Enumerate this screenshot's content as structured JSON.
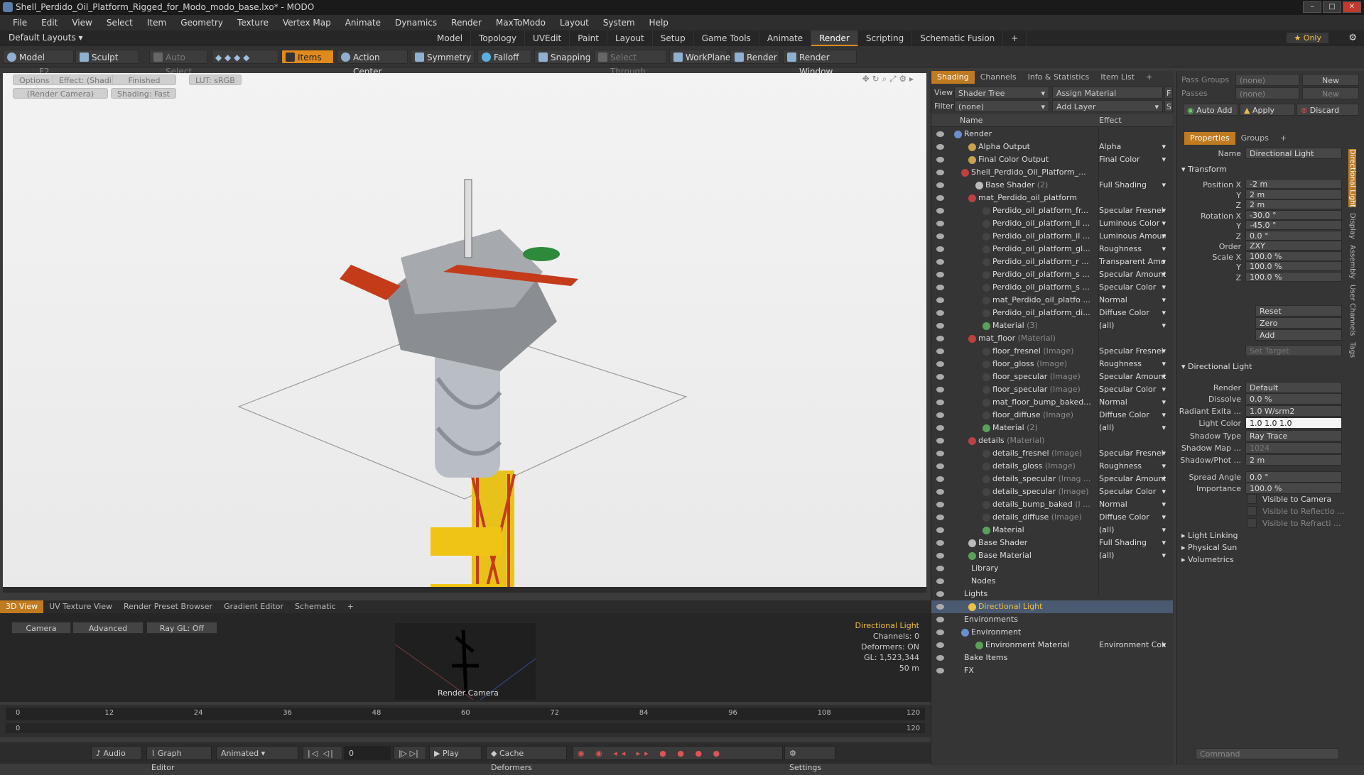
{
  "title": "Shell_Perdido_Oil_Platform_Rigged_for_Modo_modo_base.lxo* - MODO",
  "menu": [
    "File",
    "Edit",
    "View",
    "Select",
    "Item",
    "Geometry",
    "Texture",
    "Vertex Map",
    "Animate",
    "Dynamics",
    "Render",
    "MaxToModo",
    "Layout",
    "System",
    "Help"
  ],
  "layout": {
    "label": "Default Layouts ▾",
    "tabs": [
      "Model",
      "Topology",
      "UVEdit",
      "Paint",
      "Layout",
      "Setup",
      "Game Tools",
      "Animate",
      "Render",
      "Scripting",
      "Schematic Fusion"
    ],
    "active": "Render",
    "only": "★ Only"
  },
  "toolbar": {
    "model": "Model",
    "f2": "F2",
    "sculpt": "Sculpt",
    "auto_select": "Auto Select",
    "items": "Items",
    "action_center": "Action Center",
    "symmetry": "Symmetry",
    "falloff": "Falloff",
    "snapping": "Snapping",
    "select_through": "Select Through",
    "workplane": "WorkPlane",
    "render": "Render",
    "render_window": "Render Window"
  },
  "viewport": {
    "options": "Options",
    "effect": "Effect: (Shadi...",
    "finished": "Finished",
    "lut": "LUT: sRGB",
    "render_camera": "(Render Camera)",
    "shading": "Shading: Fast"
  },
  "bottom_tabs": [
    "3D View",
    "UV Texture View",
    "Render Preset Browser",
    "Gradient Editor",
    "Schematic",
    "+"
  ],
  "preview": {
    "camera": "Camera",
    "advanced": "Advanced",
    "raygl": "Ray GL: Off",
    "cam_label": "Render Camera",
    "info": [
      "Directional Light",
      "Channels: 0",
      "Deformers: ON",
      "GL: 1,523,344",
      "50 m"
    ]
  },
  "timeline": {
    "ticks": [
      "0",
      "12",
      "24",
      "36",
      "48",
      "60",
      "72",
      "84",
      "96",
      "108",
      "120"
    ],
    "ticks2": [
      "0",
      "",
      "",
      "",
      "",
      "120"
    ]
  },
  "transport": {
    "audio": "Audio",
    "graph_editor": "Graph Editor",
    "animated": "Animated",
    "frame": "0",
    "play": "Play",
    "cache": "Cache Deformers",
    "settings": "Settings"
  },
  "shading": {
    "tabs": [
      "Shading",
      "Channels",
      "Info & Statistics",
      "Item List",
      "+"
    ],
    "view_label": "View",
    "view_value": "Shader Tree",
    "assign": "Assign Material",
    "filter_label": "Filter",
    "filter_value": "(none)",
    "add_layer": "Add Layer",
    "f_btn": "F",
    "s_btn": "S",
    "col_name": "Name",
    "col_effect": "Effect",
    "rows": [
      {
        "name": "Render",
        "gray": "",
        "effect": "",
        "indent": 0,
        "color": "#6a8fd0"
      },
      {
        "name": "Alpha Output",
        "gray": "",
        "effect": "Alpha",
        "indent": 2,
        "color": "#c9a24a"
      },
      {
        "name": "Final Color Output",
        "gray": "",
        "effect": "Final Color",
        "indent": 2,
        "color": "#c9a24a"
      },
      {
        "name": "Shell_Perdido_Oil_Platform_...",
        "gray": "",
        "effect": "",
        "indent": 1,
        "color": "#c04040"
      },
      {
        "name": "Base Shader",
        "gray": " (2)",
        "effect": "Full Shading",
        "indent": 3,
        "color": "#bbbbbb"
      },
      {
        "name": "mat_Perdido_oil_platform",
        "gray": "",
        "effect": "",
        "indent": 2,
        "color": "#c04040"
      },
      {
        "name": "Perdido_oil_platform_fr...",
        "gray": "",
        "effect": "Specular Fresnel",
        "indent": 4,
        "color": "#444"
      },
      {
        "name": "Perdido_oil_platform_il ...",
        "gray": "",
        "effect": "Luminous Color",
        "indent": 4,
        "color": "#444"
      },
      {
        "name": "Perdido_oil_platform_il ...",
        "gray": "",
        "effect": "Luminous Amount",
        "indent": 4,
        "color": "#444"
      },
      {
        "name": "Perdido_oil_platform_gl...",
        "gray": "",
        "effect": "Roughness",
        "indent": 4,
        "color": "#444"
      },
      {
        "name": "Perdido_oil_platform_r ...",
        "gray": "",
        "effect": "Transparent Amo...",
        "indent": 4,
        "color": "#444"
      },
      {
        "name": "Perdido_oil_platform_s ...",
        "gray": "",
        "effect": "Specular Amount",
        "indent": 4,
        "color": "#444"
      },
      {
        "name": "Perdido_oil_platform_s ...",
        "gray": "",
        "effect": "Specular Color",
        "indent": 4,
        "color": "#444"
      },
      {
        "name": "mat_Perdido_oil_platfo ...",
        "gray": "",
        "effect": "Normal",
        "indent": 4,
        "color": "#444"
      },
      {
        "name": "Perdido_oil_platform_di...",
        "gray": "",
        "effect": "Diffuse Color",
        "indent": 4,
        "color": "#444"
      },
      {
        "name": "Material",
        "gray": " (3)",
        "effect": "(all)",
        "indent": 4,
        "color": "#5aa05a"
      },
      {
        "name": "mat_floor",
        "gray": " (Material)",
        "effect": "",
        "indent": 2,
        "color": "#c04040"
      },
      {
        "name": "floor_fresnel",
        "gray": " (Image)",
        "effect": "Specular Fresnel",
        "indent": 4,
        "color": "#444"
      },
      {
        "name": "floor_gloss",
        "gray": " (Image)",
        "effect": "Roughness",
        "indent": 4,
        "color": "#444"
      },
      {
        "name": "floor_specular",
        "gray": " (Image)",
        "effect": "Specular Amount",
        "indent": 4,
        "color": "#444"
      },
      {
        "name": "floor_specular",
        "gray": " (Image)",
        "effect": "Specular Color",
        "indent": 4,
        "color": "#444"
      },
      {
        "name": "mat_floor_bump_baked...",
        "gray": "",
        "effect": "Normal",
        "indent": 4,
        "color": "#444"
      },
      {
        "name": "floor_diffuse",
        "gray": " (Image)",
        "effect": "Diffuse Color",
        "indent": 4,
        "color": "#444"
      },
      {
        "name": "Material",
        "gray": " (2)",
        "effect": "(all)",
        "indent": 4,
        "color": "#5aa05a"
      },
      {
        "name": "details",
        "gray": " (Material)",
        "effect": "",
        "indent": 2,
        "color": "#c04040"
      },
      {
        "name": "details_fresnel",
        "gray": " (Image)",
        "effect": "Specular Fresnel",
        "indent": 4,
        "color": "#444"
      },
      {
        "name": "details_gloss",
        "gray": " (Image)",
        "effect": "Roughness",
        "indent": 4,
        "color": "#444"
      },
      {
        "name": "details_specular",
        "gray": " (Imag ...",
        "effect": "Specular Amount",
        "indent": 4,
        "color": "#444"
      },
      {
        "name": "details_specular",
        "gray": " (Image)",
        "effect": "Specular Color",
        "indent": 4,
        "color": "#444"
      },
      {
        "name": "details_bump_baked",
        "gray": " (I ...",
        "effect": "Normal",
        "indent": 4,
        "color": "#444"
      },
      {
        "name": "details_diffuse",
        "gray": " (Image)",
        "effect": "Diffuse Color",
        "indent": 4,
        "color": "#444"
      },
      {
        "name": "Material",
        "gray": "",
        "effect": "(all)",
        "indent": 4,
        "color": "#5aa05a"
      },
      {
        "name": "Base Shader",
        "gray": "",
        "effect": "Full Shading",
        "indent": 2,
        "color": "#bbbbbb"
      },
      {
        "name": "Base Material",
        "gray": "",
        "effect": "(all)",
        "indent": 2,
        "color": "#5aa05a"
      },
      {
        "name": "Library",
        "gray": "",
        "effect": "",
        "indent": 1,
        "color": ""
      },
      {
        "name": "Nodes",
        "gray": "",
        "effect": "",
        "indent": 1,
        "color": ""
      },
      {
        "name": "Lights",
        "gray": "",
        "effect": "",
        "indent": 0,
        "color": ""
      },
      {
        "name": "Directional Light",
        "gray": "",
        "effect": "",
        "indent": 2,
        "color": "#f0c040",
        "sel": true
      },
      {
        "name": "Environments",
        "gray": "",
        "effect": "",
        "indent": 0,
        "color": ""
      },
      {
        "name": "Environment",
        "gray": "",
        "effect": "",
        "indent": 1,
        "color": "#6a8fd0"
      },
      {
        "name": "Environment Material",
        "gray": "",
        "effect": "Environment Color",
        "indent": 3,
        "color": "#5aa05a"
      },
      {
        "name": "Bake Items",
        "gray": "",
        "effect": "",
        "indent": 0,
        "color": ""
      },
      {
        "name": "FX",
        "gray": "",
        "effect": "",
        "indent": 0,
        "color": ""
      }
    ]
  },
  "props": {
    "pass_groups": "Pass Groups",
    "passes": "Passes",
    "none": "(none)",
    "new": "New",
    "auto_add": "Auto Add",
    "apply": "Apply",
    "discard": "Discard",
    "tabs": [
      "Properties",
      "Groups",
      "+"
    ],
    "name_label": "Name",
    "name_value": "Directional Light",
    "transform": "Transform",
    "fields": [
      {
        "label": "Position X",
        "value": "-2 m"
      },
      {
        "label": "Y",
        "value": "2 m"
      },
      {
        "label": "Z",
        "value": "2 m"
      },
      {
        "label": "Rotation X",
        "value": "-30.0 °"
      },
      {
        "label": "Y",
        "value": "-45.0 °"
      },
      {
        "label": "Z",
        "value": "0.0 °"
      },
      {
        "label": "Order",
        "value": "ZXY"
      },
      {
        "label": "Scale X",
        "value": "100.0 %"
      },
      {
        "label": "Y",
        "value": "100.0 %"
      },
      {
        "label": "Z",
        "value": "100.0 %"
      }
    ],
    "reset": "Reset",
    "zero": "Zero",
    "add": "Add",
    "set_target": "Set Target",
    "dl_section": "Directional Light",
    "dl_fields": [
      {
        "label": "Render",
        "value": "Default"
      },
      {
        "label": "Dissolve",
        "value": "0.0 %"
      },
      {
        "label": "Radiant Exita ...",
        "value": "1.0 W/srm2"
      },
      {
        "label": "Light Color",
        "value": "1.0     1.0     1.0"
      },
      {
        "label": "Shadow Type",
        "value": "Ray Trace"
      },
      {
        "label": "Shadow Map ...",
        "value": "1024"
      },
      {
        "label": "Shadow/Phot ...",
        "value": "2 m"
      },
      {
        "label": "Spread Angle",
        "value": "0.0 °"
      },
      {
        "label": "Importance",
        "value": "100.0 %"
      }
    ],
    "checks": [
      "Visible to Camera",
      "Visible to Reflectio ...",
      "Visible to Refracti ..."
    ],
    "sections": [
      "Light Linking",
      "Physical Sun",
      "Volumetrics"
    ],
    "command": "Command",
    "side_tabs": [
      "Directional Light",
      "Display",
      "Assembly",
      "User Channels",
      "Tags"
    ]
  }
}
